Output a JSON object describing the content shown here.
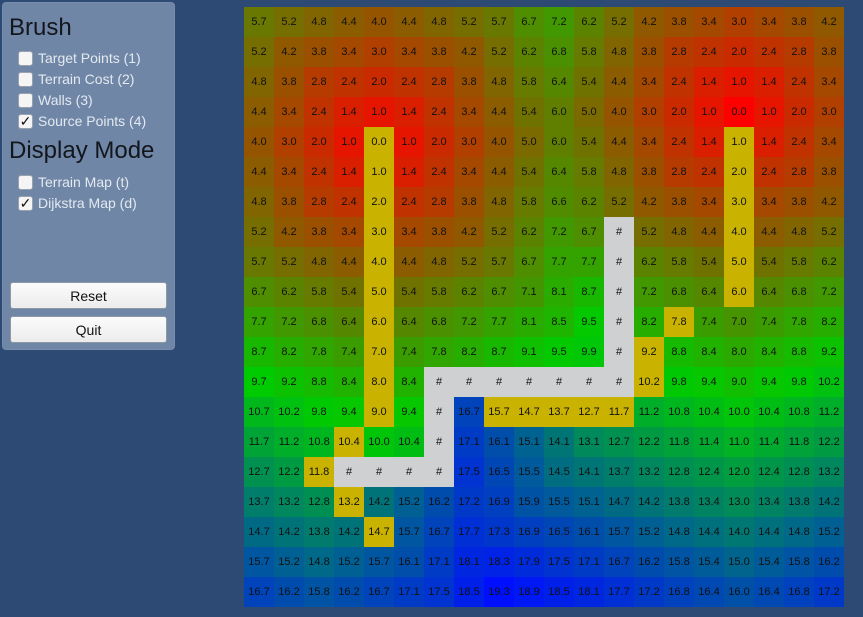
{
  "brush": {
    "title": "Brush",
    "options": [
      {
        "label": "Target Points (1)",
        "checked": false
      },
      {
        "label": "Terrain Cost (2)",
        "checked": false
      },
      {
        "label": "Walls (3)",
        "checked": false
      },
      {
        "label": "Source Points (4)",
        "checked": true
      }
    ]
  },
  "display_mode": {
    "title": "Display Mode",
    "options": [
      {
        "label": "Terrain Map (t)",
        "checked": false
      },
      {
        "label": "Dijkstra Map (d)",
        "checked": true
      }
    ]
  },
  "buttons": {
    "reset": "Reset",
    "quit": "Quit"
  },
  "check_glyph": "✓",
  "grid": {
    "columns": 20,
    "rows": 20,
    "wall_label": "#",
    "colors": {
      "low": "#ff0000",
      "mid": "#00cc00",
      "high": "#0010ff",
      "wall": "#cfd0d2",
      "target": "#c9b200"
    },
    "max_value": 19.3,
    "cells": [
      [
        "5.7",
        "5.2",
        "4.8",
        "4.4",
        "4.0",
        "4.4",
        "4.8",
        "5.2",
        "5.7",
        "6.7",
        "7.2",
        "6.2",
        "5.2",
        "4.2",
        "3.8",
        "3.4",
        "3.0",
        "3.4",
        "3.8",
        "4.2"
      ],
      [
        "5.2",
        "4.2",
        "3.8",
        "3.4",
        "3.0",
        "3.4",
        "3.8",
        "4.2",
        "5.2",
        "6.2",
        "6.8",
        "5.8",
        "4.8",
        "3.8",
        "2.8",
        "2.4",
        "2.0",
        "2.4",
        "2.8",
        "3.8"
      ],
      [
        "4.8",
        "3.8",
        "2.8",
        "2.4",
        "2.0",
        "2.4",
        "2.8",
        "3.8",
        "4.8",
        "5.8",
        "6.4",
        "5.4",
        "4.4",
        "3.4",
        "2.4",
        "1.4",
        "1.0",
        "1.4",
        "2.4",
        "3.4"
      ],
      [
        "4.4",
        "3.4",
        "2.4",
        "1.4",
        "1.0",
        "1.4",
        "2.4",
        "3.4",
        "4.4",
        "5.4",
        "6.0",
        "5.0",
        "4.0",
        "3.0",
        "2.0",
        "1.0",
        "0.0",
        "1.0",
        "2.0",
        "3.0"
      ],
      [
        "4.0",
        "3.0",
        "2.0",
        "1.0",
        "0.0",
        "1.0",
        "2.0",
        "3.0",
        "4.0",
        "5.0",
        "6.0",
        "5.4",
        "4.4",
        "3.4",
        "2.4",
        "1.4",
        "1.0",
        "1.4",
        "2.4",
        "3.4"
      ],
      [
        "4.4",
        "3.4",
        "2.4",
        "1.4",
        "1.0",
        "1.4",
        "2.4",
        "3.4",
        "4.4",
        "5.4",
        "6.4",
        "5.8",
        "4.8",
        "3.8",
        "2.8",
        "2.4",
        "2.0",
        "2.4",
        "2.8",
        "3.8"
      ],
      [
        "4.8",
        "3.8",
        "2.8",
        "2.4",
        "2.0",
        "2.4",
        "2.8",
        "3.8",
        "4.8",
        "5.8",
        "6.6",
        "6.2",
        "5.2",
        "4.2",
        "3.8",
        "3.4",
        "3.0",
        "3.4",
        "3.8",
        "4.2"
      ],
      [
        "5.2",
        "4.2",
        "3.8",
        "3.4",
        "3.0",
        "3.4",
        "3.8",
        "4.2",
        "5.2",
        "6.2",
        "7.2",
        "6.7",
        "#",
        "5.2",
        "4.8",
        "4.4",
        "4.0",
        "4.4",
        "4.8",
        "5.2"
      ],
      [
        "5.7",
        "5.2",
        "4.8",
        "4.4",
        "4.0",
        "4.4",
        "4.8",
        "5.2",
        "5.7",
        "6.7",
        "7.7",
        "7.7",
        "#",
        "6.2",
        "5.8",
        "5.4",
        "5.0",
        "5.4",
        "5.8",
        "6.2"
      ],
      [
        "6.7",
        "6.2",
        "5.8",
        "5.4",
        "5.0",
        "5.4",
        "5.8",
        "6.2",
        "6.7",
        "7.1",
        "8.1",
        "8.7",
        "#",
        "7.2",
        "6.8",
        "6.4",
        "6.0",
        "6.4",
        "6.8",
        "7.2"
      ],
      [
        "7.7",
        "7.2",
        "6.8",
        "6.4",
        "6.0",
        "6.4",
        "6.8",
        "7.2",
        "7.7",
        "8.1",
        "8.5",
        "9.5",
        "#",
        "8.2",
        "7.8",
        "7.4",
        "7.0",
        "7.4",
        "7.8",
        "8.2"
      ],
      [
        "8.7",
        "8.2",
        "7.8",
        "7.4",
        "7.0",
        "7.4",
        "7.8",
        "8.2",
        "8.7",
        "9.1",
        "9.5",
        "9.9",
        "#",
        "9.2",
        "8.8",
        "8.4",
        "8.0",
        "8.4",
        "8.8",
        "9.2"
      ],
      [
        "9.7",
        "9.2",
        "8.8",
        "8.4",
        "8.0",
        "8.4",
        "#",
        "#",
        "#",
        "#",
        "#",
        "#",
        "#",
        "10.2",
        "9.8",
        "9.4",
        "9.0",
        "9.4",
        "9.8",
        "10.2"
      ],
      [
        "10.7",
        "10.2",
        "9.8",
        "9.4",
        "9.0",
        "9.4",
        "#",
        "16.7",
        "15.7",
        "14.7",
        "13.7",
        "12.7",
        "11.7",
        "11.2",
        "10.8",
        "10.4",
        "10.0",
        "10.4",
        "10.8",
        "11.2"
      ],
      [
        "11.7",
        "11.2",
        "10.8",
        "10.4",
        "10.0",
        "10.4",
        "#",
        "17.1",
        "16.1",
        "15.1",
        "14.1",
        "13.1",
        "12.7",
        "12.2",
        "11.8",
        "11.4",
        "11.0",
        "11.4",
        "11.8",
        "12.2"
      ],
      [
        "12.7",
        "12.2",
        "11.8",
        "#",
        "#",
        "#",
        "#",
        "17.5",
        "16.5",
        "15.5",
        "14.5",
        "14.1",
        "13.7",
        "13.2",
        "12.8",
        "12.4",
        "12.0",
        "12.4",
        "12.8",
        "13.2"
      ],
      [
        "13.7",
        "13.2",
        "12.8",
        "13.2",
        "14.2",
        "15.2",
        "16.2",
        "17.2",
        "16.9",
        "15.9",
        "15.5",
        "15.1",
        "14.7",
        "14.2",
        "13.8",
        "13.4",
        "13.0",
        "13.4",
        "13.8",
        "14.2"
      ],
      [
        "14.7",
        "14.2",
        "13.8",
        "14.2",
        "14.7",
        "15.7",
        "16.7",
        "17.7",
        "17.3",
        "16.9",
        "16.5",
        "16.1",
        "15.7",
        "15.2",
        "14.8",
        "14.4",
        "14.0",
        "14.4",
        "14.8",
        "15.2"
      ],
      [
        "15.7",
        "15.2",
        "14.8",
        "15.2",
        "15.7",
        "16.1",
        "17.1",
        "18.1",
        "18.3",
        "17.9",
        "17.5",
        "17.1",
        "16.7",
        "16.2",
        "15.8",
        "15.4",
        "15.0",
        "15.4",
        "15.8",
        "16.2"
      ],
      [
        "16.7",
        "16.2",
        "15.8",
        "16.2",
        "16.7",
        "17.1",
        "17.5",
        "18.5",
        "19.3",
        "18.9",
        "18.5",
        "18.1",
        "17.7",
        "17.2",
        "16.8",
        "16.4",
        "16.0",
        "16.4",
        "16.8",
        "17.2"
      ]
    ],
    "target_cells": [
      [
        4,
        4
      ],
      [
        5,
        4
      ],
      [
        6,
        4
      ],
      [
        7,
        4
      ],
      [
        8,
        4
      ],
      [
        9,
        4
      ],
      [
        10,
        4
      ],
      [
        11,
        4
      ],
      [
        12,
        4
      ],
      [
        13,
        4
      ],
      [
        4,
        16
      ],
      [
        5,
        16
      ],
      [
        6,
        16
      ],
      [
        7,
        16
      ],
      [
        8,
        16
      ],
      [
        9,
        16
      ],
      [
        10,
        14
      ],
      [
        11,
        13
      ],
      [
        12,
        13
      ],
      [
        13,
        8
      ],
      [
        13,
        9
      ],
      [
        13,
        10
      ],
      [
        13,
        11
      ],
      [
        13,
        12
      ],
      [
        14,
        3
      ],
      [
        15,
        2
      ],
      [
        16,
        3
      ],
      [
        17,
        4
      ]
    ]
  }
}
